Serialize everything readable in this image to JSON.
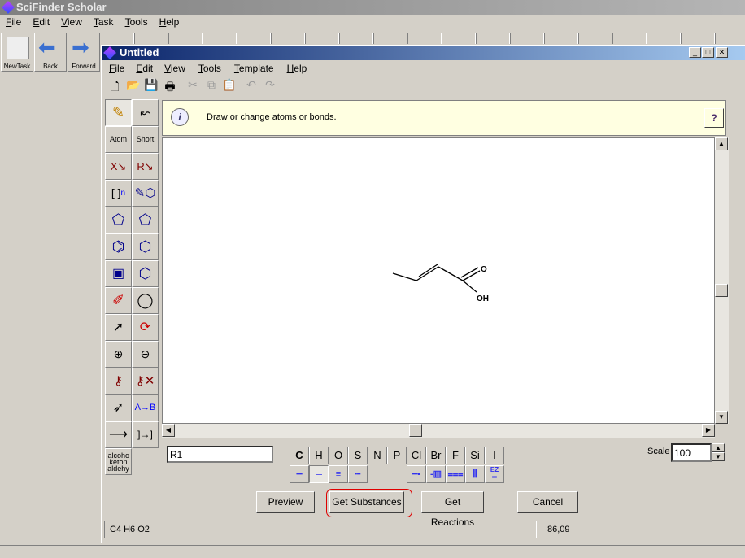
{
  "app": {
    "title": "SciFinder Scholar",
    "menu": [
      "File",
      "Edit",
      "View",
      "Task",
      "Tools",
      "Help"
    ],
    "toolbar": [
      {
        "label": "NewTask",
        "icon": "task-list-icon"
      },
      {
        "label": "Back",
        "icon": "back-arrow-icon"
      },
      {
        "label": "Forward",
        "icon": "forward-arrow-icon"
      }
    ]
  },
  "window": {
    "title": "Untitled",
    "menu": [
      "File",
      "Edit",
      "View",
      "Tools",
      "Template",
      "Help"
    ],
    "toolbar_icons": [
      "new-icon",
      "open-icon",
      "save-icon",
      "print-icon",
      "cut-icon",
      "copy-icon",
      "paste-icon",
      "undo-icon",
      "redo-icon"
    ]
  },
  "palette": [
    "pencil",
    "chain",
    "Atom",
    "Short",
    "X",
    "R",
    "[ ]n",
    "pencil-ring",
    "cyclopentene",
    "cyclopentane",
    "benzene",
    "cyclohexane",
    "template",
    "ring-n",
    "eraser",
    "lasso",
    "select",
    "rotate",
    "zoom-in",
    "zoom-out",
    "lock-atom",
    "unlock-atom",
    "select-bond",
    "A→B",
    "→",
    "reaction-map",
    "alcohol ketone aldehyde"
  ],
  "palette_text": {
    "atom": "Atom",
    "short": "Short",
    "x": "X",
    "r": "R",
    "n": "n",
    "ab": "A→B",
    "func": "alcohc keton aldehy"
  },
  "info": {
    "message": "Draw or change atoms or bonds.",
    "help": "?"
  },
  "structure": {
    "atoms": [
      "O",
      "OH"
    ],
    "formula": "C4 H6 O2"
  },
  "rgroup_value": "R1",
  "elements": [
    "C",
    "H",
    "O",
    "S",
    "N",
    "P",
    "Cl",
    "Br",
    "F",
    "Si",
    "I"
  ],
  "bonds": [
    "single",
    "double",
    "triple",
    "any",
    "wedge-up",
    "wedge-down",
    "stereo-double",
    "hashed",
    "EZ"
  ],
  "bond_ez_label": "EZ",
  "scale": {
    "label": "Scale",
    "value": "100"
  },
  "buttons": {
    "preview": "Preview",
    "substances": "Get Substances",
    "reactions": "Get Reactions",
    "cancel": "Cancel"
  },
  "status": {
    "formula": "C4 H6 O2",
    "mw": "86,09"
  },
  "colors": {
    "highlight": "#e00000",
    "info_bg": "#ffffe1",
    "bond_blue": "#3333ee"
  }
}
